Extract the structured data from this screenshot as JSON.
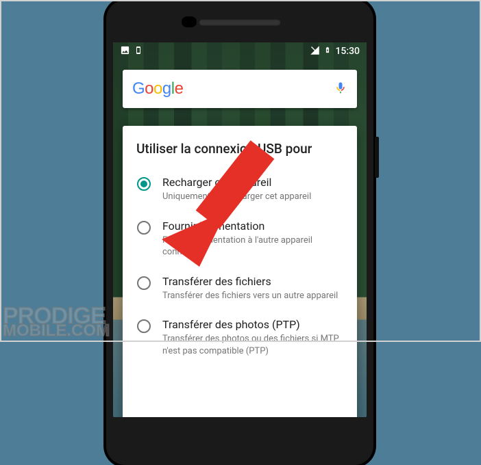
{
  "statusbar": {
    "time": "15:30"
  },
  "search": {
    "logo": "Google"
  },
  "dialog": {
    "title": "Utiliser la connexion USB pour",
    "options": [
      {
        "label": "Recharger cet appareil",
        "desc": "Uniquement pour charger cet appareil",
        "selected": true
      },
      {
        "label": "Fournir l'alimentation",
        "desc": "Fournir l'alimentation à l'autre appareil connecté",
        "selected": false
      },
      {
        "label": "Transférer des fichiers",
        "desc": "Transférer des fichiers vers un autre appareil",
        "selected": false
      },
      {
        "label": "Transférer des photos (PTP)",
        "desc": "Transférer des photos ou des fichiers si MTP n'est pas compatible (PTP)",
        "selected": false
      }
    ]
  },
  "watermark": {
    "line1": "PRODIGE",
    "line2": "MOBILE.COM"
  }
}
